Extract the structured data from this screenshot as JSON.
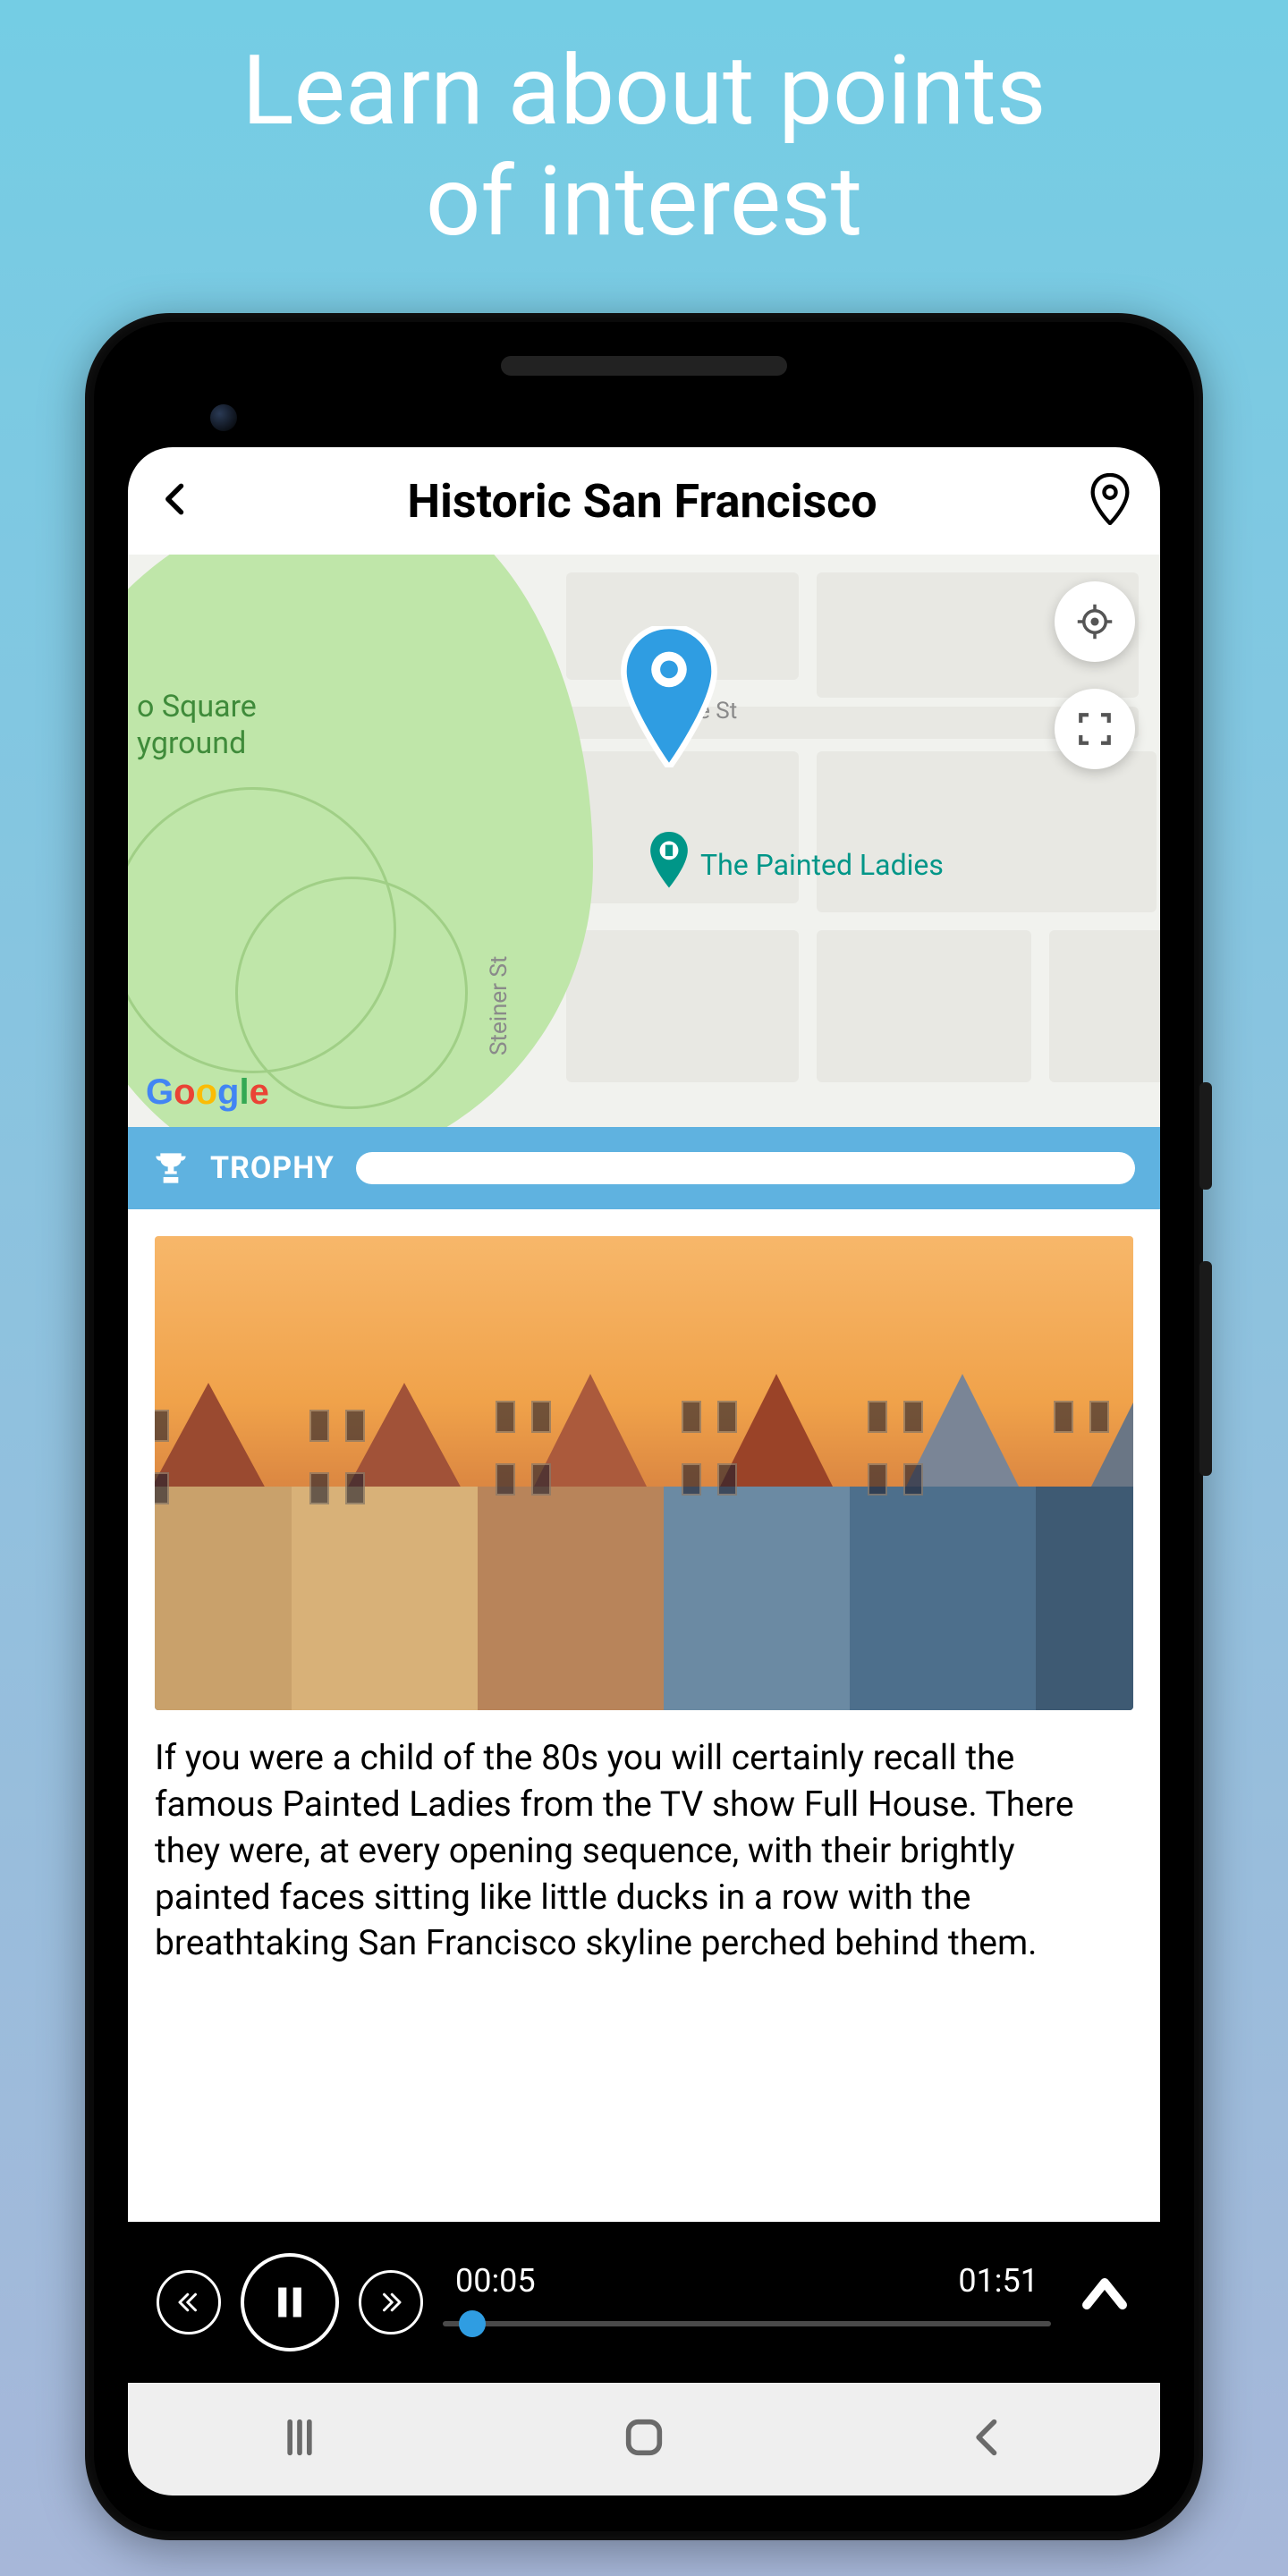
{
  "promo": {
    "line1": "Learn about points",
    "line2": "of interest"
  },
  "header": {
    "title": "Historic San Francisco"
  },
  "map": {
    "park_label_line1": "o Square",
    "park_label_line2": "yground",
    "street_vertical": "Steiner St",
    "street_horizontal": "ove St",
    "poi_name": "The Painted Ladies",
    "attribution": "Google"
  },
  "trophy": {
    "label": "TROPHY",
    "progress_percent": 0
  },
  "article": {
    "body": "If you were a child of the 80s you will certainly recall the famous Painted Ladies from the TV show Full House. There they were, at every opening sequence, with their brightly painted faces sitting like little ducks in a row with the breathtaking San Francisco skyline perched behind them."
  },
  "player": {
    "current_time": "00:05",
    "total_time": "01:51"
  },
  "colors": {
    "accent_blue": "#5fb2e0",
    "pin_blue": "#2f9de2",
    "poi_teal": "#009688"
  }
}
